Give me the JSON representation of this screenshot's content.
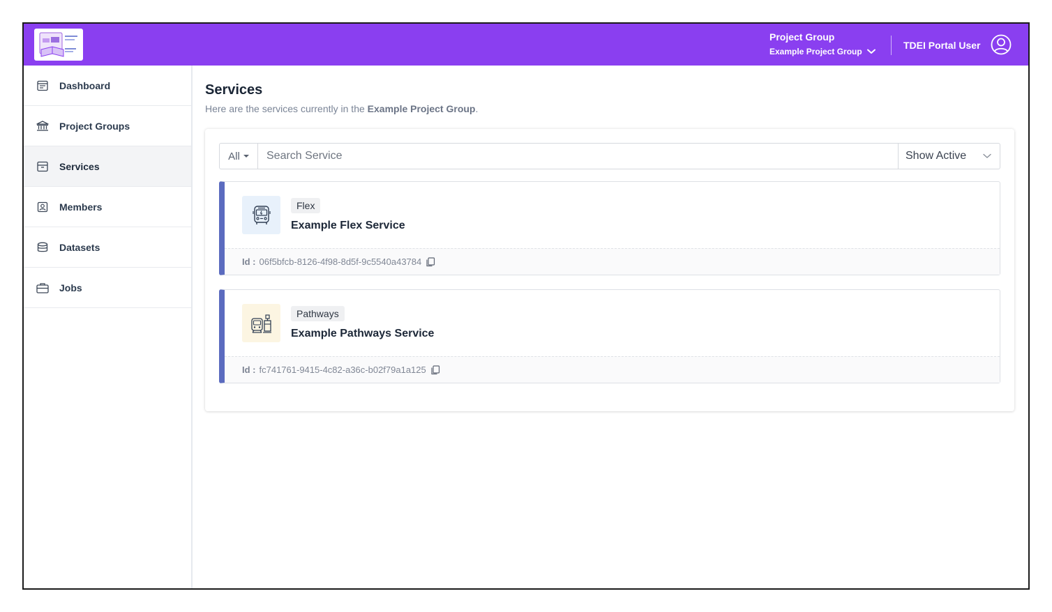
{
  "header": {
    "project_group_label": "Project Group",
    "project_group_value": "Example Project Group",
    "user_name": "TDEI Portal User",
    "brand_color": "#8a3ff0"
  },
  "sidebar": {
    "items": [
      {
        "label": "Dashboard",
        "icon": "dashboard-icon"
      },
      {
        "label": "Project Groups",
        "icon": "bank-icon"
      },
      {
        "label": "Services",
        "icon": "archive-box-icon",
        "active": true
      },
      {
        "label": "Members",
        "icon": "member-badge-icon"
      },
      {
        "label": "Datasets",
        "icon": "database-icon"
      },
      {
        "label": "Jobs",
        "icon": "briefcase-icon"
      }
    ]
  },
  "main": {
    "title": "Services",
    "subtitle_prefix": "Here are the services currently in the ",
    "subtitle_group": "Example Project Group",
    "subtitle_suffix": ".",
    "filter_label": "All",
    "search_placeholder": "Search Service",
    "status_label": "Show Active",
    "services": [
      {
        "type": "Flex",
        "name": "Example Flex Service",
        "id_label": "Id :",
        "id": "06f5bfcb-8126-4f98-8d5f-9c5540a43784",
        "icon": "bus-icon"
      },
      {
        "type": "Pathways",
        "name": "Example Pathways Service",
        "id_label": "Id :",
        "id": "fc741761-9415-4c82-a36c-b02f79a1a125",
        "icon": "train-station-icon"
      }
    ],
    "accent_color": "#5b6bbf"
  }
}
